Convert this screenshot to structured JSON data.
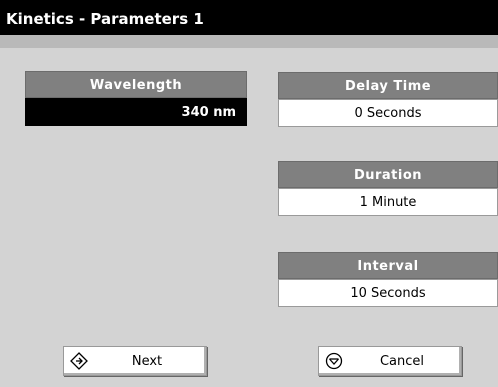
{
  "window": {
    "title": "Kinetics - Parameters 1"
  },
  "fields": {
    "wavelength": {
      "label": "Wavelength",
      "value": "340 nm"
    },
    "delay_time": {
      "label": "Delay Time",
      "value": "0 Seconds"
    },
    "duration": {
      "label": "Duration",
      "value": "1 Minute"
    },
    "interval": {
      "label": "Interval",
      "value": "10 Seconds"
    }
  },
  "buttons": {
    "next": {
      "label": "Next",
      "icon": "diamond-enter-icon"
    },
    "cancel": {
      "label": "Cancel",
      "icon": "circle-chevron-down-icon"
    }
  },
  "colors": {
    "background": "#d3d3d3",
    "header": "#808080",
    "title_bar": "#000000",
    "selected_value": "#000000"
  }
}
